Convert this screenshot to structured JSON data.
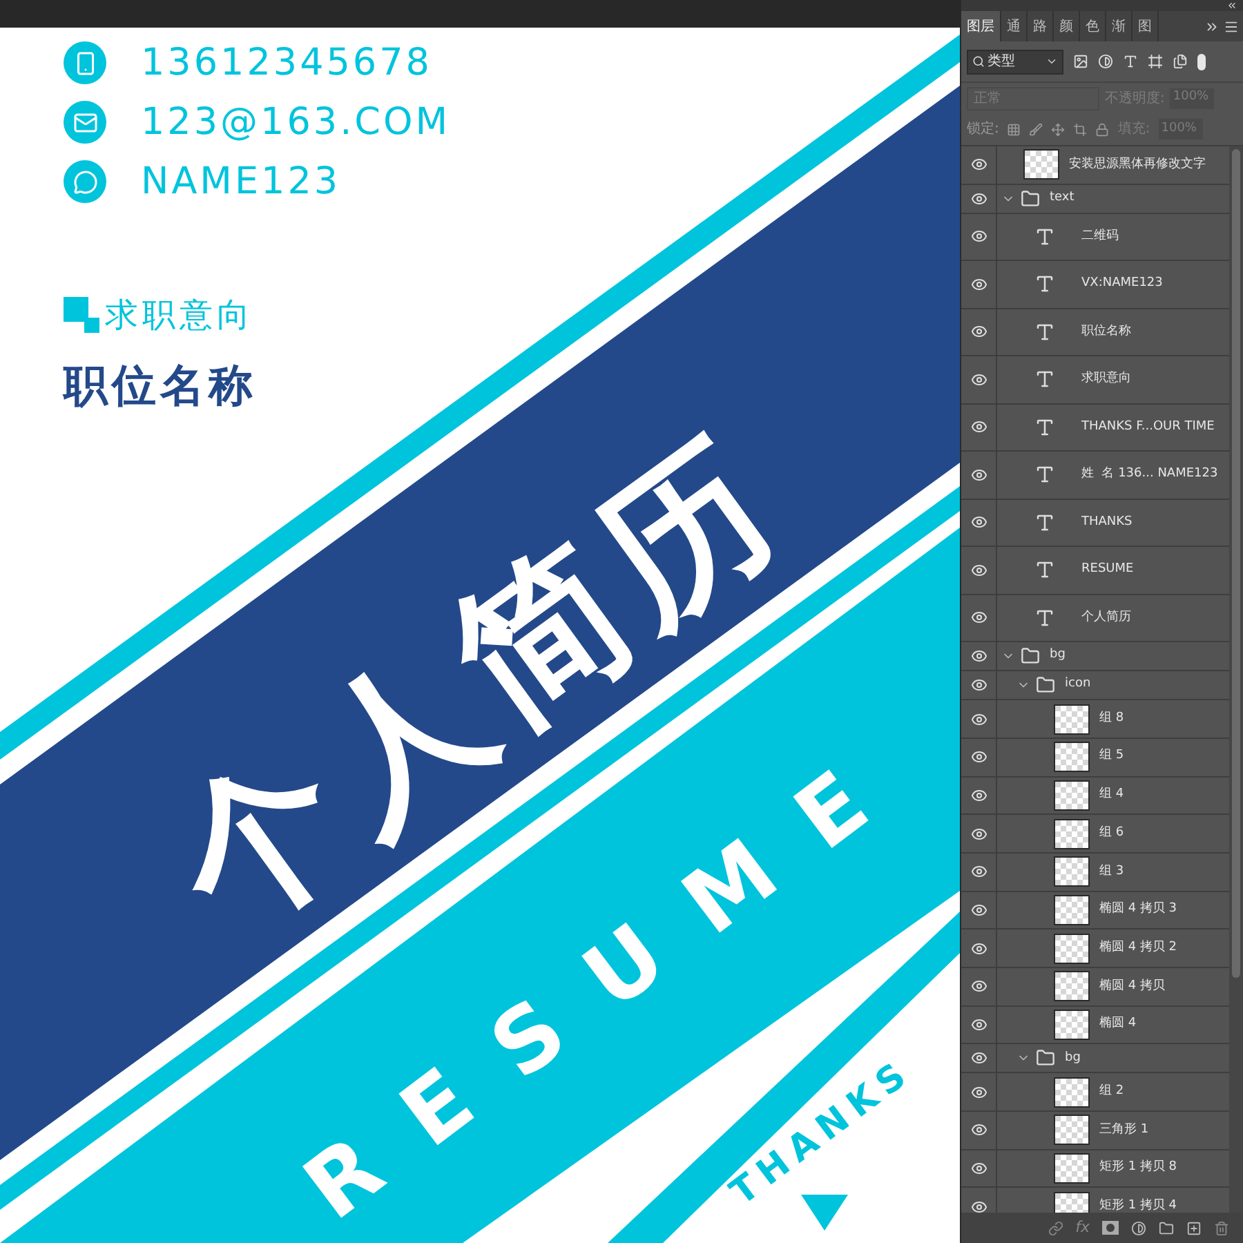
{
  "canvas": {
    "contacts": [
      {
        "kind": "phone",
        "text": "13612345678"
      },
      {
        "kind": "email",
        "text": "123@163.COM"
      },
      {
        "kind": "chat",
        "text": "NAME123"
      }
    ],
    "intent_label": "求职意向",
    "position": "职位名称",
    "title": "个人简历",
    "resume": "RESUME",
    "thanks": "THANKS"
  },
  "panel": {
    "tabs": [
      {
        "label": "图层",
        "selected": true
      },
      {
        "label": "通",
        "selected": false
      },
      {
        "label": "路",
        "selected": false
      },
      {
        "label": "颜",
        "selected": false
      },
      {
        "label": "色",
        "selected": false
      },
      {
        "label": "渐",
        "selected": false
      },
      {
        "label": "图",
        "selected": false
      }
    ],
    "filter": {
      "value": "类型"
    },
    "blend_mode": {
      "value": "正常",
      "disabled": true
    },
    "opacity": {
      "label": "不透明度:",
      "value": "100%",
      "disabled": true
    },
    "lock_label": "锁定:",
    "fill": {
      "label": "填充:",
      "value": "100%",
      "disabled": true
    },
    "layers": [
      {
        "name": "安装思源黑体再修改文字",
        "kind": "image",
        "visible": true
      },
      {
        "name": "text",
        "kind": "group",
        "visible": true,
        "expanded": true,
        "children": [
          {
            "name": "二维码",
            "kind": "text",
            "visible": true
          },
          {
            "name": "VX:NAME123",
            "kind": "text",
            "visible": true
          },
          {
            "name": "职位名称",
            "kind": "text",
            "visible": true
          },
          {
            "name": "求职意向",
            "kind": "text",
            "visible": true
          },
          {
            "name": "THANKS F...OUR TIME",
            "kind": "text",
            "visible": true
          },
          {
            "name": "姓  名 136... NAME123",
            "kind": "text",
            "visible": true
          },
          {
            "name": "THANKS",
            "kind": "text",
            "visible": true
          },
          {
            "name": "RESUME",
            "kind": "text",
            "visible": true
          },
          {
            "name": "个人简历",
            "kind": "text",
            "visible": true
          }
        ]
      },
      {
        "name": "bg",
        "kind": "group",
        "visible": true,
        "expanded": true,
        "children": [
          {
            "name": "icon",
            "kind": "group",
            "visible": true,
            "expanded": true,
            "children": [
              {
                "name": "组 8",
                "kind": "image",
                "visible": true
              },
              {
                "name": "组 5",
                "kind": "image",
                "visible": true
              },
              {
                "name": "组 4",
                "kind": "image",
                "visible": true
              },
              {
                "name": "组 6",
                "kind": "image",
                "visible": true
              },
              {
                "name": "组 3",
                "kind": "image",
                "visible": true
              },
              {
                "name": "椭圆 4 拷贝 3",
                "kind": "image",
                "visible": true
              },
              {
                "name": "椭圆 4 拷贝 2",
                "kind": "image",
                "visible": true
              },
              {
                "name": "椭圆 4 拷贝",
                "kind": "image",
                "visible": true
              },
              {
                "name": "椭圆 4",
                "kind": "image",
                "visible": true
              }
            ]
          },
          {
            "name": "bg",
            "kind": "group",
            "visible": true,
            "expanded": true,
            "children": [
              {
                "name": "组 2",
                "kind": "image",
                "visible": true
              },
              {
                "name": "三角形 1",
                "kind": "image",
                "visible": true
              },
              {
                "name": "矩形 1 拷贝 8",
                "kind": "image",
                "visible": true
              },
              {
                "name": "矩形 1 拷贝 4",
                "kind": "image",
                "visible": true
              }
            ]
          }
        ]
      }
    ],
    "fx_label": "fx"
  }
}
